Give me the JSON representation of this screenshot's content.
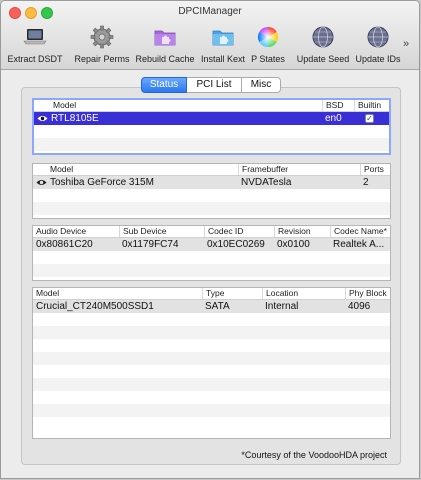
{
  "window": {
    "title": "DPCIManager"
  },
  "toolbar": {
    "items": [
      {
        "label": "Extract DSDT",
        "icon": "laptop-icon"
      },
      {
        "label": "Repair Perms",
        "icon": "gear-icon"
      },
      {
        "label": "Rebuild Cache",
        "icon": "puzzle-folder-icon"
      },
      {
        "label": "Install Kext",
        "icon": "kext-folder-icon"
      },
      {
        "label": "P States",
        "icon": "color-wheel-icon"
      },
      {
        "label": "Update Seed",
        "icon": "update-globe-icon"
      },
      {
        "label": "Update IDs",
        "icon": "update-globe-icon"
      }
    ],
    "more": "»"
  },
  "tabs": [
    {
      "label": "Status",
      "active": true
    },
    {
      "label": "PCI List",
      "active": false
    },
    {
      "label": "Misc",
      "active": false
    }
  ],
  "network_table": {
    "headers": [
      "Model",
      "BSD",
      "Builtin"
    ],
    "rows": [
      {
        "model": "RTL8105E",
        "bsd": "en0",
        "builtin": true
      }
    ]
  },
  "graphics_table": {
    "headers": [
      "Model",
      "Framebuffer",
      "Ports"
    ],
    "rows": [
      {
        "model": "Toshiba GeForce 315M",
        "framebuffer": "NVDATesla",
        "ports": "2"
      }
    ]
  },
  "audio_table": {
    "headers": [
      "Audio Device",
      "Sub Device",
      "Codec ID",
      "Revision",
      "Codec Name*"
    ],
    "rows": [
      {
        "audio_device": "0x80861C20",
        "sub_device": "0x1179FC74",
        "codec_id": "0x10EC0269",
        "revision": "0x0100",
        "codec_name": "Realtek A..."
      }
    ]
  },
  "storage_table": {
    "headers": [
      "Model",
      "Type",
      "Location",
      "Phy Block"
    ],
    "rows": [
      {
        "model": "Crucial_CT240M500SSD1",
        "type": "SATA",
        "location": "Internal",
        "phy_block": "4096"
      }
    ]
  },
  "footer": {
    "note": "*Courtesy of the VoodooHDA project"
  },
  "colors": {
    "selection": "#3a2fd6",
    "accent_tab": "#2a78f0",
    "window_bg": "#ececec"
  }
}
